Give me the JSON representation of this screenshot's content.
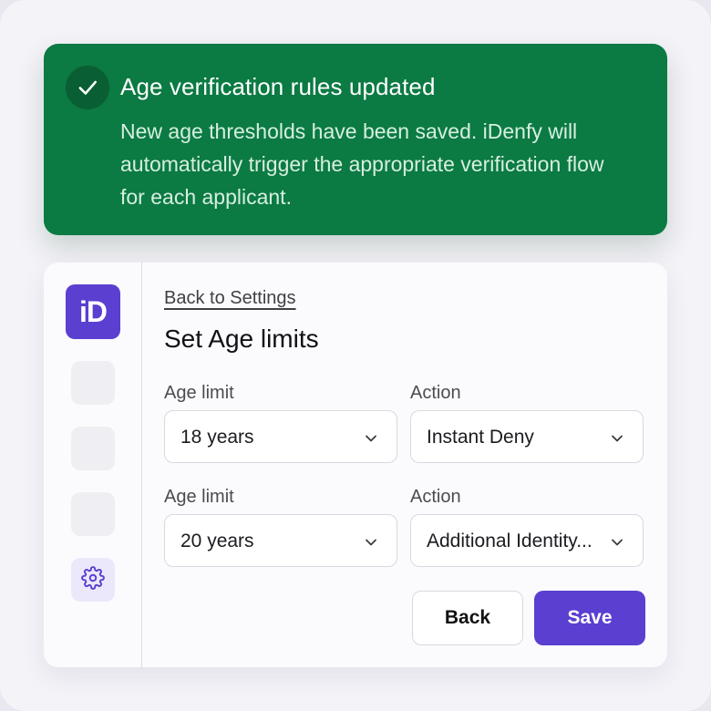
{
  "toast": {
    "title": "Age verification rules updated",
    "message": "New age thresholds have been saved. iDenfy will automatically trigger the appropriate verification flow for each applicant.",
    "icon": "check-icon",
    "background": "#0b7a43"
  },
  "sidebar": {
    "logo_text": "iD",
    "logo_color": "#5b3fd0",
    "settings_icon": "gear-icon"
  },
  "main": {
    "back_link": "Back to Settings",
    "title": "Set Age limits",
    "rules": [
      {
        "age_label": "Age limit",
        "age_value": "18 years",
        "action_label": "Action",
        "action_value": "Instant Deny"
      },
      {
        "age_label": "Age limit",
        "age_value": "20 years",
        "action_label": "Action",
        "action_value": "Additional Identity..."
      }
    ],
    "back_button": "Back",
    "save_button": "Save"
  }
}
